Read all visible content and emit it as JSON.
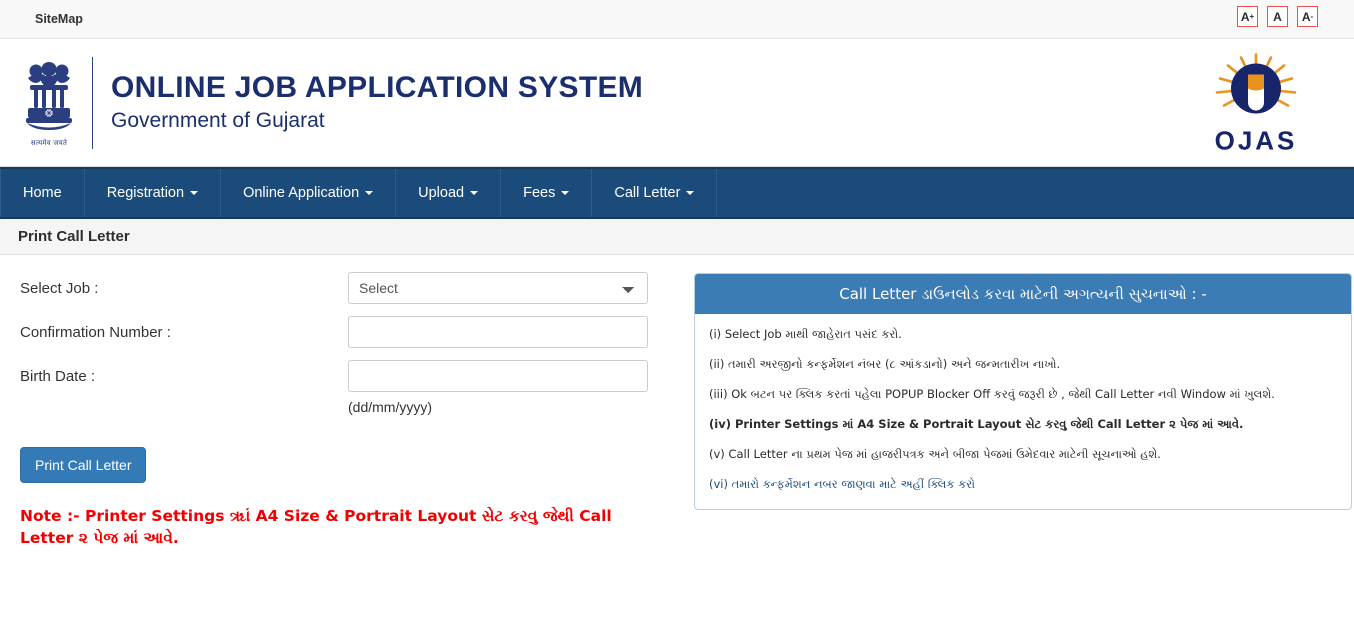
{
  "topbar": {
    "sitemap_label": "SiteMap",
    "font_controls": [
      {
        "name": "font-increase-button",
        "label": "A",
        "modifier": "+"
      },
      {
        "name": "font-normal-button",
        "label": "A",
        "modifier": ""
      },
      {
        "name": "font-decrease-button",
        "label": "A",
        "modifier": "-"
      }
    ],
    "font_control_border_color": "#e8534f"
  },
  "masthead": {
    "emblem_name": "india-state-emblem-icon",
    "emblem_motto": "सत्यमेव जयते",
    "title": "ONLINE JOB APPLICATION SYSTEM",
    "subtitle": "Government of Gujarat",
    "title_color": "#1b2f6e",
    "logo_text": "OJAS",
    "logo_name": "ojas-sun-logo",
    "logo_navy": "#17256b",
    "logo_orange": "#e8921f"
  },
  "nav": {
    "background_color": "#1b4b7a",
    "items": [
      {
        "label": "Home",
        "has_caret": false
      },
      {
        "label": "Registration",
        "has_caret": true
      },
      {
        "label": "Online Application",
        "has_caret": true
      },
      {
        "label": "Upload",
        "has_caret": true
      },
      {
        "label": "Fees",
        "has_caret": true
      },
      {
        "label": "Call Letter",
        "has_caret": true
      }
    ]
  },
  "page": {
    "title": "Print Call Letter"
  },
  "form": {
    "select_job_label": "Select Job :",
    "select_job_value": "Select",
    "select_job_options": [
      "Select"
    ],
    "confirmation_label": "Confirmation Number :",
    "confirmation_value": "",
    "confirmation_placeholder": "",
    "birth_date_label": "Birth Date :",
    "birth_date_value": "",
    "birth_date_placeholder": "",
    "birth_date_hint": "(dd/mm/yyyy)",
    "submit_label": "Print Call Letter",
    "submit_color": "#337ab7",
    "note": "Note :- Printer Settings ૠાં A4 Size & Portrait Layout સેટ કરવુ જેથી Call Letter ૨ પેજ માં આવે.",
    "note_color": "#f20000"
  },
  "instructions_panel": {
    "heading": "Call Letter ડાઉનલોડ કરવા માટેની અગત્યની સુચનાઓ : -",
    "heading_color": "#3b7cb5",
    "items": [
      {
        "text": "(i) Select Job માથી જાહેરાત પસંદ કરો.",
        "style": "normal"
      },
      {
        "text": "(ii) તમારી અરજીનો કન્ફર્મેશન નંબર (૮ આંકડાનો) અને જન્મતારીખ નાખો.",
        "style": "normal"
      },
      {
        "text": "(iii) Ok બટન પર ક્લિક કરતાં પહેલા POPUP Blocker Off કરવું જરૂરી છે , જેથી Call Letter નવી Window માં ખુલશે.",
        "style": "normal"
      },
      {
        "text": "(iv) Printer Settings માં A4 Size & Portrait Layout સેટ કરવુ જેથી Call Letter ૨ પેજ માં આવે.",
        "style": "bold"
      },
      {
        "text": "(v) Call Letter ના પ્રથમ પેજ માં હાજરીપત્રક અને બીજા પેજમાં ઉમેદવાર માટેની સૂચનાઓ હશે.",
        "style": "normal"
      },
      {
        "text": "(vi) તમારો કન્ફર્મેશન નબર જાણવા માટે અહીં ક્લિક કરો",
        "style": "link"
      }
    ]
  }
}
